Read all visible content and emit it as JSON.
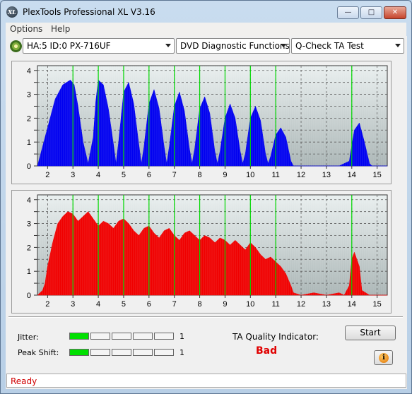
{
  "window": {
    "title": "PlexTools Professional XL V3.16",
    "icon_label": "XL",
    "min_glyph": "—",
    "max_glyph": "□",
    "close_glyph": "✕"
  },
  "menu": [
    {
      "label": "Options"
    },
    {
      "label": "Help"
    }
  ],
  "toolbar": {
    "drive": "HA:5 ID:0  PX-716UF",
    "function": "DVD Diagnostic Functions",
    "test": "Q-Check TA Test"
  },
  "colors": {
    "top_series": "#0000f0",
    "bottom_series": "#f00000",
    "marker": "#00d800",
    "plot_bg_top": "#e9efef",
    "plot_bg_bottom": "#aab5b5"
  },
  "chart_data": [
    {
      "type": "area",
      "series": [
        {
          "color": "#0000f0",
          "x": [
            1.6,
            2.0,
            2.3,
            2.6,
            2.9,
            3.05,
            3.2,
            3.4,
            3.6,
            3.8,
            3.9,
            4.0,
            4.2,
            4.4,
            4.6,
            4.7,
            4.8,
            5.0,
            5.2,
            5.4,
            5.6,
            5.7,
            5.8,
            6.0,
            6.2,
            6.4,
            6.6,
            6.7,
            6.8,
            7.0,
            7.2,
            7.4,
            7.6,
            7.7,
            7.8,
            8.0,
            8.2,
            8.4,
            8.6,
            8.7,
            8.8,
            9.0,
            9.2,
            9.4,
            9.6,
            9.7,
            9.8,
            10.0,
            10.2,
            10.4,
            10.6,
            10.7,
            10.8,
            11.0,
            11.2,
            11.4,
            11.6,
            11.7,
            12.0,
            12.5,
            13.0,
            13.5,
            13.9,
            14.1,
            14.3,
            14.5,
            14.7,
            14.8,
            15.4
          ],
          "values": [
            0,
            1.6,
            2.8,
            3.4,
            3.6,
            3.4,
            2.5,
            1.0,
            0.1,
            1.2,
            2.7,
            3.6,
            3.4,
            2.4,
            0.9,
            0.1,
            1.0,
            3.1,
            3.5,
            2.6,
            0.9,
            0.1,
            0.8,
            2.6,
            3.2,
            2.4,
            0.8,
            0.1,
            0.8,
            2.5,
            3.1,
            2.3,
            0.7,
            0.1,
            0.7,
            2.4,
            2.9,
            2.2,
            0.6,
            0.1,
            0.6,
            2.0,
            2.6,
            2.0,
            0.6,
            0.1,
            0.5,
            2.0,
            2.5,
            1.9,
            0.5,
            0.1,
            0.4,
            1.3,
            1.6,
            1.2,
            0.2,
            0,
            0,
            0,
            0,
            0,
            0.2,
            1.5,
            1.8,
            1.0,
            0.1,
            0,
            0
          ]
        }
      ],
      "x_ticks": [
        "2",
        "3",
        "4",
        "5",
        "6",
        "7",
        "8",
        "9",
        "10",
        "11",
        "12",
        "13",
        "14",
        "15"
      ],
      "y_ticks": [
        "0",
        "0.5",
        "1",
        "1.5",
        "2",
        "2.5",
        "3",
        "3.5",
        "4"
      ],
      "markers_x": [
        3,
        4,
        5,
        6,
        7,
        8,
        9,
        10,
        11,
        14
      ],
      "xlim": [
        1.6,
        15.4
      ],
      "ylim": [
        0,
        4.2
      ],
      "grid": true
    },
    {
      "type": "area",
      "series": [
        {
          "color": "#f00000",
          "x": [
            1.6,
            1.8,
            1.9,
            2.0,
            2.2,
            2.4,
            2.6,
            2.8,
            3.0,
            3.2,
            3.4,
            3.6,
            3.8,
            4.0,
            4.2,
            4.4,
            4.6,
            4.8,
            5.0,
            5.2,
            5.4,
            5.6,
            5.8,
            6.0,
            6.2,
            6.4,
            6.6,
            6.8,
            7.0,
            7.2,
            7.4,
            7.6,
            7.8,
            8.0,
            8.2,
            8.4,
            8.6,
            8.8,
            9.0,
            9.2,
            9.4,
            9.6,
            9.8,
            10.0,
            10.2,
            10.4,
            10.6,
            10.8,
            11.0,
            11.2,
            11.4,
            11.6,
            11.7,
            12.0,
            12.5,
            13.0,
            13.5,
            13.7,
            13.9,
            14.0,
            14.1,
            14.3,
            14.4,
            14.7,
            15.4
          ],
          "values": [
            0,
            0.2,
            0.5,
            1.2,
            2.2,
            3.0,
            3.3,
            3.5,
            3.4,
            3.1,
            3.3,
            3.5,
            3.2,
            2.9,
            3.1,
            3.0,
            2.8,
            3.1,
            3.2,
            3.0,
            2.7,
            2.5,
            2.8,
            2.9,
            2.6,
            2.4,
            2.7,
            2.8,
            2.5,
            2.3,
            2.6,
            2.7,
            2.5,
            2.3,
            2.5,
            2.4,
            2.2,
            2.4,
            2.3,
            2.1,
            2.3,
            2.1,
            1.9,
            2.2,
            2.0,
            1.7,
            1.5,
            1.6,
            1.4,
            1.2,
            0.9,
            0.4,
            0.1,
            0,
            0.1,
            0,
            0.1,
            0,
            0.4,
            1.5,
            1.8,
            1.2,
            0.2,
            0,
            0
          ]
        }
      ],
      "x_ticks": [
        "2",
        "3",
        "4",
        "5",
        "6",
        "7",
        "8",
        "9",
        "10",
        "11",
        "12",
        "13",
        "14",
        "15"
      ],
      "y_ticks": [
        "0",
        "0.5",
        "1",
        "1.5",
        "2",
        "2.5",
        "3",
        "3.5",
        "4"
      ],
      "markers_x": [
        3,
        4,
        5,
        6,
        7,
        8,
        9,
        10,
        11,
        14
      ],
      "xlim": [
        1.6,
        15.4
      ],
      "ylim": [
        0,
        4.2
      ],
      "grid": true
    }
  ],
  "meters": {
    "jitter": {
      "label": "Jitter:",
      "level": 1,
      "cells": 5,
      "value": "1"
    },
    "peak_shift": {
      "label": "Peak Shift:",
      "level": 1,
      "cells": 5,
      "value": "1"
    }
  },
  "ta": {
    "label": "TA Quality Indicator:",
    "value": "Bad"
  },
  "buttons": {
    "start": "Start",
    "info": "i"
  },
  "status": {
    "text": "Ready"
  }
}
